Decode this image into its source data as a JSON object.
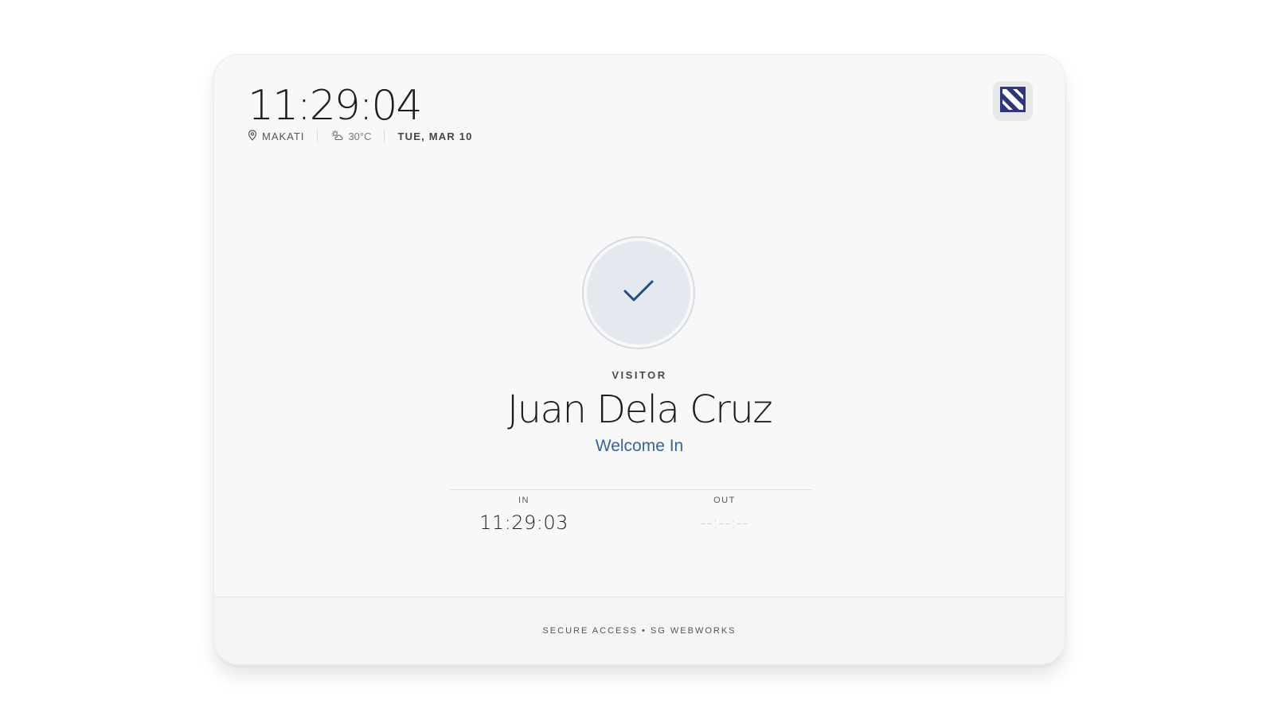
{
  "header": {
    "clock": "11:29:04",
    "location": "MAKATI",
    "location_icon": "map-pin-icon",
    "weather_icon": "partly-cloudy-icon",
    "temperature": "30°C",
    "date": "TUE, MAR 10",
    "logo_icon": "sg-logo-icon",
    "logo_color": "#2f3680"
  },
  "status": {
    "icon": "check-icon",
    "icon_color": "#1f4d85",
    "role": "VISITOR",
    "name": "Juan Dela Cruz",
    "greeting": "Welcome In",
    "greeting_color": "#3a6592"
  },
  "times": {
    "in_label": "IN",
    "in_value": "11:29:03",
    "out_label": "OUT",
    "out_value": "--:--:--"
  },
  "footer": {
    "text": "SECURE ACCESS • SG WEBWORKS"
  }
}
